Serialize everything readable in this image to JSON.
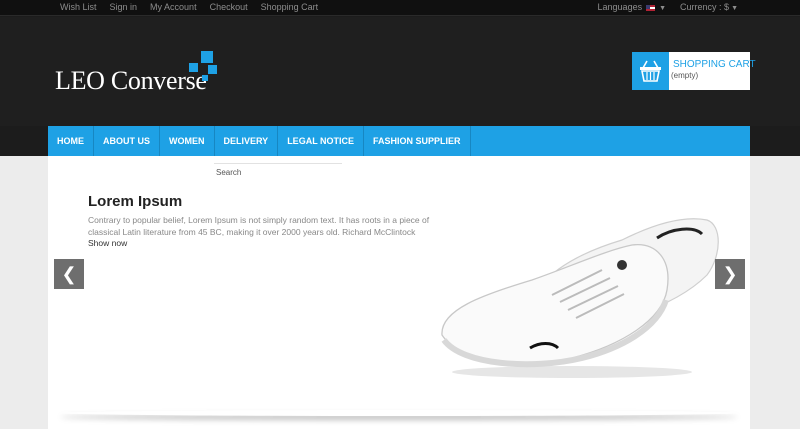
{
  "topbar": {
    "links": [
      "Wish List",
      "Sign in",
      "My Account",
      "Checkout",
      "Shopping Cart"
    ],
    "languages_label": "Languages",
    "currency_label": "Currency :",
    "currency_value": "$"
  },
  "header": {
    "logo_text": "LEO Converse",
    "cart_title": "SHOPPING CART",
    "cart_status": "(empty)"
  },
  "nav": {
    "items": [
      "HOME",
      "ABOUT US",
      "WOMEN",
      "DELIVERY",
      "LEGAL NOTICE",
      "FASHION SUPPLIER"
    ]
  },
  "search": {
    "label": "Search"
  },
  "slider": {
    "title": "Lorem Ipsum",
    "text": "Contrary to popular belief, Lorem Ipsum is not simply random text. It has roots in a piece of classical Latin literature from 45 BC, making it over 2000 years old. Richard McClintock",
    "cta": "Show now",
    "prev_icon": "❮",
    "next_icon": "❯"
  },
  "colors": {
    "accent": "#1ea1e5",
    "header_bg": "#1f1f1f",
    "topbar_bg": "#101010"
  }
}
